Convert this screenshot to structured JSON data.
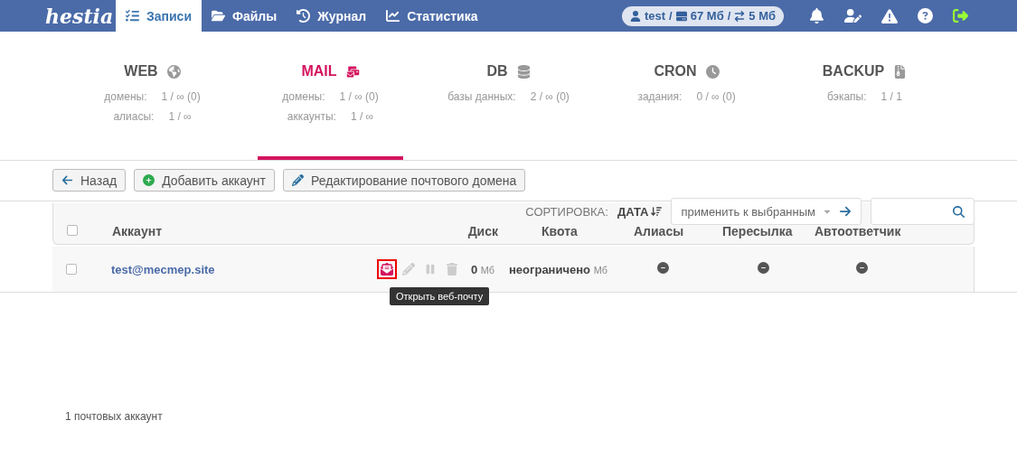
{
  "topbar": {
    "logo": "hestia",
    "nav": [
      {
        "label": "Записи",
        "kind": "list",
        "selected": true
      },
      {
        "label": "Файлы",
        "kind": "folder",
        "selected": false
      },
      {
        "label": "Журнал",
        "kind": "history",
        "selected": false
      },
      {
        "label": "Статистика",
        "kind": "chart",
        "selected": false
      }
    ],
    "usage": {
      "user": "test",
      "separator_1": "/",
      "disk": "67 Мб",
      "separator_2": "/",
      "bandwidth": "5 Мб"
    }
  },
  "stats": [
    {
      "title": "WEB",
      "kind": "globe",
      "selected": false,
      "lines": [
        {
          "label": "домены:",
          "value": "1 / ∞ (0)"
        },
        {
          "label": "алиасы:",
          "value": "1 / ∞"
        }
      ]
    },
    {
      "title": "MAIL",
      "kind": "mail",
      "selected": true,
      "lines": [
        {
          "label": "домены:",
          "value": "1 / ∞ (0)"
        },
        {
          "label": "аккаунты:",
          "value": "1 / ∞"
        }
      ]
    },
    {
      "title": "DB",
      "kind": "database",
      "selected": false,
      "lines": [
        {
          "label": "базы данных:",
          "value": "2 / ∞ (0)"
        }
      ]
    },
    {
      "title": "CRON",
      "kind": "clock",
      "selected": false,
      "lines": [
        {
          "label": "задания:",
          "value": "0 / ∞ (0)"
        }
      ]
    },
    {
      "title": "BACKUP",
      "kind": "file",
      "selected": false,
      "lines": [
        {
          "label": "бэкапы:",
          "value": "1 / 1"
        }
      ]
    }
  ],
  "buttons": [
    {
      "label": "Назад",
      "kind": "back"
    },
    {
      "label": "Добавить аккаунт",
      "kind": "add"
    },
    {
      "label": "Редактирование почтового домена",
      "kind": "edit"
    }
  ],
  "toolbar": {
    "sort_label": "СОРТИРОВКА:",
    "sort_value": "ДАТА",
    "bulk_action": "применить к выбранным"
  },
  "table": {
    "select_all_checked": false,
    "columns": [
      "Аккаунт",
      "Диск",
      "Квота",
      "Алиасы",
      "Пересылка",
      "Автоответчик"
    ],
    "rows": [
      {
        "checked": false,
        "account": "test@mecmep.site",
        "actions": [
          {
            "kind": "webmail",
            "highlighted": true
          },
          {
            "kind": "edit",
            "highlighted": false
          },
          {
            "kind": "suspend",
            "highlighted": false
          },
          {
            "kind": "delete",
            "highlighted": false
          }
        ],
        "disk": "0",
        "disk_unit": "Мб",
        "quota": "неограничено",
        "quota_unit": "Мб"
      }
    ]
  },
  "tooltip": "Открыть веб-почту",
  "footer": "1 почтовых аккаунт"
}
